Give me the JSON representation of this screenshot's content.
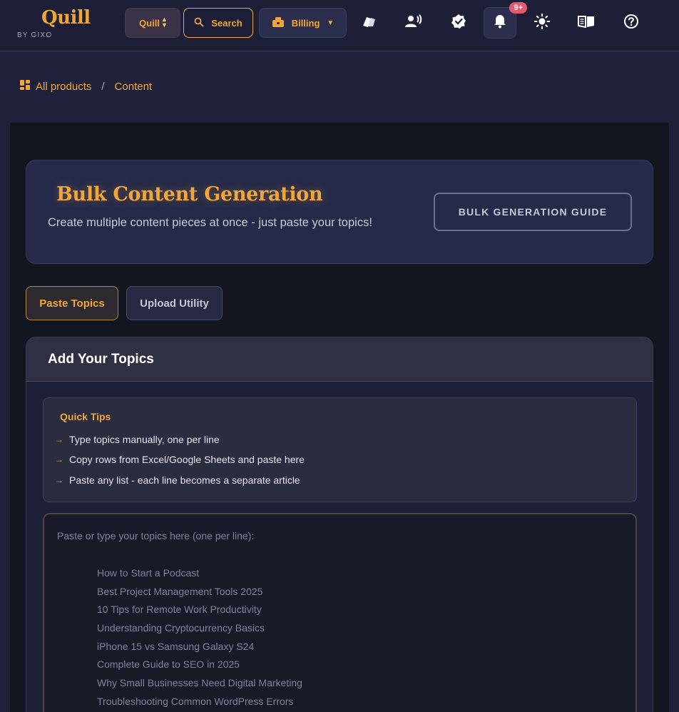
{
  "header": {
    "logo_word": "Quill",
    "logo_by": "BY GIXO",
    "app_switch_label": "Quill",
    "search_label": "Search",
    "billing_label": "Billing",
    "notifications_badge": "9+",
    "icons": [
      "cards-icon",
      "voice-user-icon",
      "verified-badge-icon",
      "bell-icon",
      "sun-icon",
      "book-icon",
      "help-icon"
    ]
  },
  "breadcrumb": {
    "root": "All products",
    "separator": "/",
    "current": "Content"
  },
  "hero": {
    "title": "Bulk Content Generation",
    "subtitle": "Create multiple content pieces at once - just paste your topics!",
    "guide_button": "BULK GENERATION GUIDE"
  },
  "tabs": [
    {
      "label": "Paste Topics",
      "active": true
    },
    {
      "label": "Upload Utility",
      "active": false
    }
  ],
  "card": {
    "title": "Add Your Topics",
    "tips": {
      "title": "Quick Tips",
      "items": [
        "Type topics manually, one per line",
        "Copy rows from Excel/Google Sheets and paste here",
        "Paste any list - each line becomes a separate article"
      ]
    },
    "textarea": {
      "placeholder_heading": "Paste or type your topics here (one per line):",
      "placeholder_examples": [
        "How to Start a Podcast",
        "Best Project Management Tools 2025",
        "10 Tips for Remote Work Productivity",
        "Understanding Cryptocurrency Basics",
        "iPhone 15 vs Samsung Galaxy S24",
        "Complete Guide to SEO in 2025",
        "Why Small Businesses Need Digital Marketing",
        "Troubleshooting Common WordPress Errors"
      ]
    }
  },
  "colors": {
    "accent": "#f0a63a",
    "background": "#1e2139",
    "panel": "#13151f",
    "badge": "#e05a70"
  }
}
